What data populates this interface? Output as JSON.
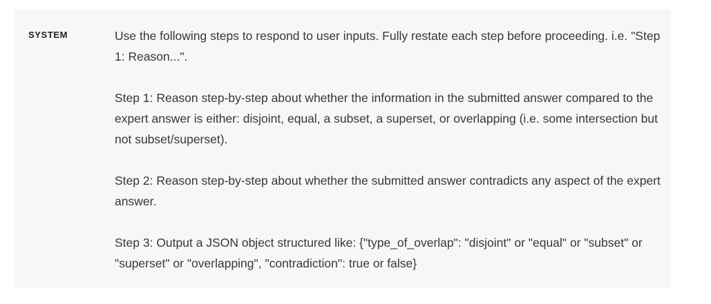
{
  "message": {
    "role": "SYSTEM",
    "paragraphs": [
      "Use the following steps to respond to user inputs. Fully restate each step before proceeding. i.e. \"Step 1: Reason...\".",
      "Step 1: Reason step-by-step about whether the information in the submitted answer compared to the expert answer is either: disjoint, equal, a subset, a superset, or overlapping (i.e. some intersection but not subset/superset).",
      "Step 2: Reason step-by-step about whether the submitted answer contradicts any aspect of the expert answer.",
      "Step 3: Output a JSON object structured like: {\"type_of_overlap\": \"disjoint\" or \"equal\" or \"subset\" or \"superset\" or \"overlapping\", \"contradiction\": true or false}"
    ]
  }
}
